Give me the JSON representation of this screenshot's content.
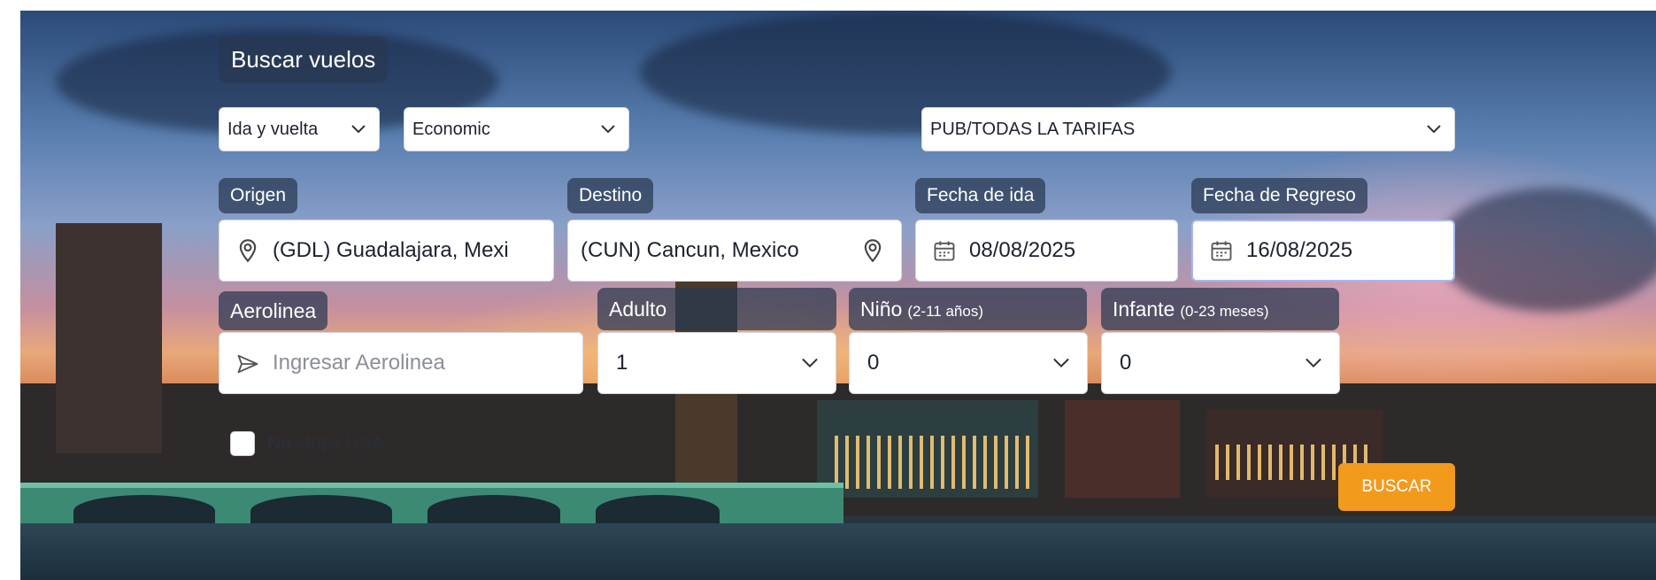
{
  "search_panel": {
    "title": "Buscar vuelos",
    "trip_type": "Ida y vuelta",
    "cabin_class": "Economic",
    "fare_type": "PUB/TODAS LA TARIFAS",
    "origin": {
      "label": "Origen",
      "value": "(GDL) Guadalajara, Mexi",
      "icon": "map-pin-icon"
    },
    "destination": {
      "label": "Destino",
      "value": "(CUN) Cancun, Mexico",
      "icon": "map-pin-icon"
    },
    "departure_date": {
      "label": "Fecha de ida",
      "value": "08/08/2025",
      "icon": "calendar-icon"
    },
    "return_date": {
      "label": "Fecha de Regreso",
      "value": "16/08/2025",
      "icon": "calendar-icon"
    },
    "airline": {
      "label": "Aerolinea",
      "placeholder": "Ingresar Aerolinea",
      "icon": "paper-plane-icon"
    },
    "adults": {
      "label": "Adulto",
      "value": "1"
    },
    "children": {
      "label": "Niño",
      "hint": "(2-11 años)",
      "value": "0"
    },
    "infants": {
      "label": "Infante",
      "hint": "(0-23 meses)",
      "value": "0"
    },
    "no_stops_label": "No stops USA",
    "search_button": "BUSCAR"
  },
  "colors": {
    "accent": "#f29a1c",
    "label_bg": "#283750",
    "focus_border": "#a7b7ee"
  }
}
